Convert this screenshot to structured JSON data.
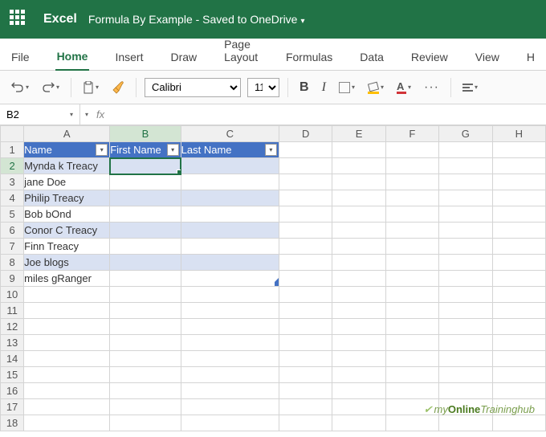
{
  "titlebar": {
    "app": "Excel",
    "doc": "Formula By Example - Saved to OneDrive"
  },
  "tabs": {
    "file": "File",
    "home": "Home",
    "insert": "Insert",
    "draw": "Draw",
    "layout": "Page Layout",
    "formulas": "Formulas",
    "data": "Data",
    "review": "Review",
    "view": "View",
    "help": "H"
  },
  "toolbar": {
    "font": "Calibri",
    "size": "11",
    "bold": "B",
    "italic": "I",
    "font_color_letter": "A",
    "more": "···"
  },
  "formula": {
    "name_box": "B2",
    "fx": "fx",
    "value": ""
  },
  "cols": [
    "A",
    "B",
    "C",
    "D",
    "E",
    "F",
    "G",
    "H"
  ],
  "rows": [
    "1",
    "2",
    "3",
    "4",
    "5",
    "6",
    "7",
    "8",
    "9",
    "10",
    "11",
    "12",
    "13",
    "14",
    "15",
    "16",
    "17",
    "18"
  ],
  "table": {
    "headers": {
      "name": "Name",
      "first": "First Name",
      "last": "Last Name"
    },
    "data": [
      {
        "name": "Mynda k Treacy"
      },
      {
        "name": "jane Doe"
      },
      {
        "name": "Philip Treacy"
      },
      {
        "name": "Bob bOnd"
      },
      {
        "name": "Conor C Treacy"
      },
      {
        "name": "Finn Treacy"
      },
      {
        "name": "Joe blogs"
      },
      {
        "name": "miles gRanger"
      }
    ]
  },
  "watermark": {
    "pre": "my",
    "mid": "Online",
    "post": "Traininghub"
  }
}
